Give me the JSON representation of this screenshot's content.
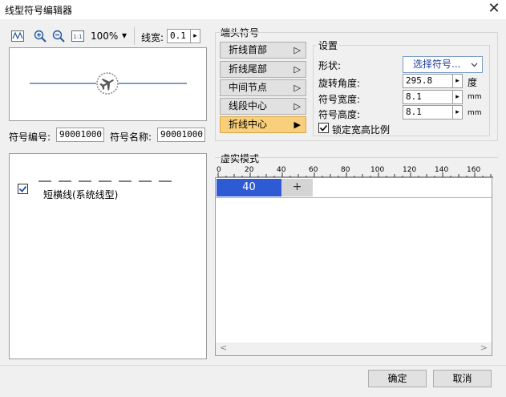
{
  "window": {
    "title": "线型符号编辑器",
    "close_glyph": "✕"
  },
  "toolbar": {
    "zoom": "100%",
    "dropdown_glyph": "▾",
    "linewidth_label": "线宽:",
    "linewidth_value": "0.1",
    "spin_glyph": "▸"
  },
  "symbol": {
    "number_label": "符号编号:",
    "number_value": "90001000",
    "name_label": "符号名称:",
    "name_value": "90001000"
  },
  "list": {
    "items": [
      {
        "label": "短横线(系统线型)"
      }
    ]
  },
  "endpoint": {
    "group_label": "端头符号",
    "buttons": [
      {
        "label": "折线首部",
        "arrow": "▷"
      },
      {
        "label": "折线尾部",
        "arrow": "▷"
      },
      {
        "label": "中间节点",
        "arrow": "▷"
      },
      {
        "label": "线段中心",
        "arrow": "▷"
      },
      {
        "label": "折线中心",
        "arrow": "▶"
      }
    ],
    "active_index": 4
  },
  "settings": {
    "group_label": "设置",
    "shape_label": "形状:",
    "shape_value": "选择符号...",
    "rotation_label": "旋转角度:",
    "rotation_value": "295.8",
    "rotation_unit": "度",
    "width_label": "符号宽度:",
    "width_value": "8.1",
    "width_unit": "mm",
    "height_label": "符号高度:",
    "height_value": "8.1",
    "height_unit": "mm",
    "lock_label": "锁定宽高比例",
    "lock_checked": true
  },
  "pattern": {
    "group_label": "虚实模式",
    "ruler_ticks": [
      "0",
      "20",
      "40",
      "60",
      "80",
      "100",
      "120",
      "140",
      "160"
    ],
    "segment_value": "40",
    "add_glyph": "+",
    "scroll_left": "<",
    "scroll_right": ">"
  },
  "footer": {
    "ok_label": "确定",
    "cancel_label": "取消"
  },
  "colors": {
    "accent_blue": "#2e5bd3",
    "active_orange": "#f9cf7c",
    "preview_line": "#4a7db5"
  }
}
